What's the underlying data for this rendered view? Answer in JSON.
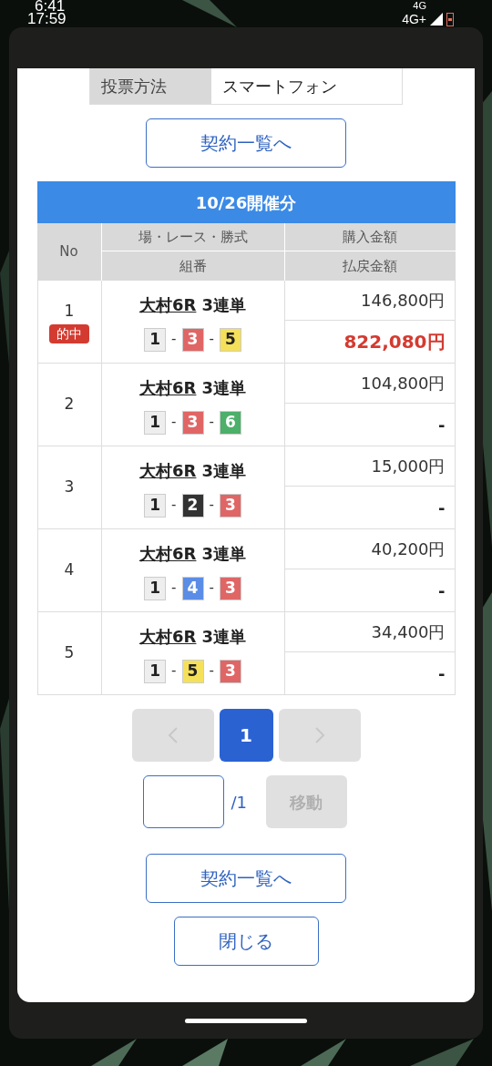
{
  "status_bar": {
    "time_top": "6:41",
    "time_bottom": "17:59",
    "network_top": "4G",
    "network_bottom": "4G+"
  },
  "vote_method": {
    "label": "投票方法",
    "value": "スマートフォン"
  },
  "contract_button_top": "契約一覧へ",
  "table": {
    "title": "10/26開催分",
    "columns": {
      "no": "No",
      "race": "場・レース・勝式",
      "combo": "組番",
      "purchase": "購入金額",
      "payout": "払戻金額"
    },
    "rows": [
      {
        "no": "1",
        "hit": true,
        "hit_label": "的中",
        "venue": "大村6R",
        "bet_type": "3連単",
        "picks": [
          {
            "number": "1",
            "color": "#eeeeee"
          },
          {
            "number": "3",
            "color": "#e06666"
          },
          {
            "number": "5",
            "color": "#f5e05a"
          }
        ],
        "separator": "-",
        "purchase": "146,800円",
        "payout": "822,080円"
      },
      {
        "no": "2",
        "hit": false,
        "venue": "大村6R",
        "bet_type": "3連単",
        "picks": [
          {
            "number": "1",
            "color": "#eeeeee"
          },
          {
            "number": "3",
            "color": "#e06666"
          },
          {
            "number": "6",
            "color": "#4caf6a"
          }
        ],
        "separator": "-",
        "purchase": "104,800円",
        "payout": "-"
      },
      {
        "no": "3",
        "hit": false,
        "venue": "大村6R",
        "bet_type": "3連単",
        "picks": [
          {
            "number": "1",
            "color": "#eeeeee"
          },
          {
            "number": "2",
            "color": "#333333"
          },
          {
            "number": "3",
            "color": "#e06666"
          }
        ],
        "separator": "-",
        "purchase": "15,000円",
        "payout": "-"
      },
      {
        "no": "4",
        "hit": false,
        "venue": "大村6R",
        "bet_type": "3連単",
        "picks": [
          {
            "number": "1",
            "color": "#eeeeee"
          },
          {
            "number": "4",
            "color": "#5b8de6"
          },
          {
            "number": "3",
            "color": "#e06666"
          }
        ],
        "separator": "-",
        "purchase": "40,200円",
        "payout": "-"
      },
      {
        "no": "5",
        "hit": false,
        "venue": "大村6R",
        "bet_type": "3連単",
        "picks": [
          {
            "number": "1",
            "color": "#eeeeee"
          },
          {
            "number": "5",
            "color": "#f5e05a"
          },
          {
            "number": "3",
            "color": "#e06666"
          }
        ],
        "separator": "-",
        "purchase": "34,400円",
        "payout": "-"
      }
    ]
  },
  "pagination": {
    "prev_disabled": true,
    "next_disabled": true,
    "pages": [
      {
        "label": "1",
        "selected": true
      }
    ],
    "total": "/1",
    "go_button": {
      "label": "移動",
      "disabled": true
    }
  },
  "contract_button_bottom": "契約一覧へ",
  "close_button": "閉じる"
}
